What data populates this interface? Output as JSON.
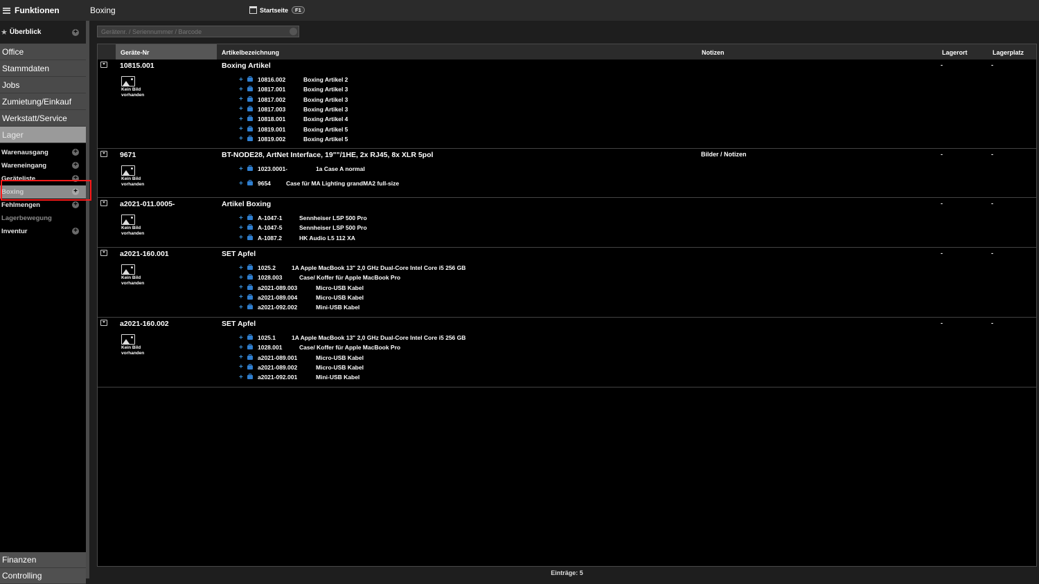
{
  "sidebar": {
    "header": "Funktionen",
    "overview": "Überblick",
    "categories": [
      "Office",
      "Stammdaten",
      "Jobs",
      "Zumietung/Einkauf",
      "Werkstatt/Service"
    ],
    "active_category": "Lager",
    "sub_items": [
      "Warenausgang",
      "Wareneingang",
      "Geräteliste",
      "Boxing",
      "Fehlmengen",
      "Lagerbewegung",
      "Inventur"
    ],
    "bottom": [
      "Finanzen",
      "Controlling"
    ]
  },
  "header": {
    "title": "Boxing",
    "home_tab": "Startseite",
    "home_key": "F1"
  },
  "search": {
    "placeholder": "Gerätenr. / Seriennummer / Barcode"
  },
  "table": {
    "columns": [
      "Geräte-Nr",
      "Artikelbezeichnung",
      "Notizen",
      "Lagerort",
      "Lagerplatz"
    ],
    "no_image": [
      "Kein Bild",
      "vorhanden"
    ],
    "groups": [
      {
        "nr": "10815.001",
        "name": "Boxing Artikel",
        "notes": "",
        "lagerort": "-",
        "lagerplatz": "-",
        "children": [
          {
            "nr": "10816.002",
            "name": "Boxing Artikel 2"
          },
          {
            "nr": "10817.001",
            "name": "Boxing Artikel 3"
          },
          {
            "nr": "10817.002",
            "name": "Boxing Artikel 3"
          },
          {
            "nr": "10817.003",
            "name": "Boxing Artikel 3"
          },
          {
            "nr": "10818.001",
            "name": "Boxing Artikel 4"
          },
          {
            "nr": "10819.001",
            "name": "Boxing Artikel 5"
          },
          {
            "nr": "10819.002",
            "name": "Boxing Artikel 5"
          }
        ]
      },
      {
        "nr": "9671",
        "name": "BT-NODE28, ArtNet Interface, 19\"\"/1HE, 2x RJ45, 8x XLR 5pol",
        "notes": "Bilder / Notizen",
        "lagerort": "-",
        "lagerplatz": "-",
        "children": [
          {
            "nr": "1023.0001-",
            "name": "1a Case A normal"
          },
          {
            "nr": "9654",
            "name": "Case für MA Lighting grandMA2 full-size"
          }
        ]
      },
      {
        "nr": "a2021-011.0005-",
        "name": "Artikel Boxing",
        "notes": "",
        "lagerort": "-",
        "lagerplatz": "-",
        "children": [
          {
            "nr": "A-1047-1",
            "name": "Sennheiser LSP 500 Pro"
          },
          {
            "nr": "A-1047-5",
            "name": "Sennheiser LSP 500 Pro"
          },
          {
            "nr": "A-1087.2",
            "name": "HK Audio L5 112 XA"
          }
        ]
      },
      {
        "nr": "a2021-160.001",
        "name": "SET Apfel",
        "notes": "",
        "lagerort": "-",
        "lagerplatz": "-",
        "children": [
          {
            "nr": "1025.2",
            "name": "1A Apple MacBook 13\" 2,0 GHz Dual-Core Intel Core i5 256 GB"
          },
          {
            "nr": "1028.003",
            "name": "Case/ Koffer für Apple MacBook Pro"
          },
          {
            "nr": "a2021-089.003",
            "name": "Micro-USB Kabel"
          },
          {
            "nr": "a2021-089.004",
            "name": "Micro-USB Kabel"
          },
          {
            "nr": "a2021-092.002",
            "name": "Mini-USB Kabel"
          }
        ]
      },
      {
        "nr": "a2021-160.002",
        "name": "SET Apfel",
        "notes": "",
        "lagerort": "-",
        "lagerplatz": "-",
        "children": [
          {
            "nr": "1025.1",
            "name": "1A Apple MacBook 13\" 2,0 GHz Dual-Core Intel Core i5 256 GB"
          },
          {
            "nr": "1028.001",
            "name": "Case/ Koffer für Apple MacBook Pro"
          },
          {
            "nr": "a2021-089.001",
            "name": "Micro-USB Kabel"
          },
          {
            "nr": "a2021-089.002",
            "name": "Micro-USB Kabel"
          },
          {
            "nr": "a2021-092.001",
            "name": "Mini-USB Kabel"
          }
        ]
      }
    ]
  },
  "footer": "Einträge: 5"
}
